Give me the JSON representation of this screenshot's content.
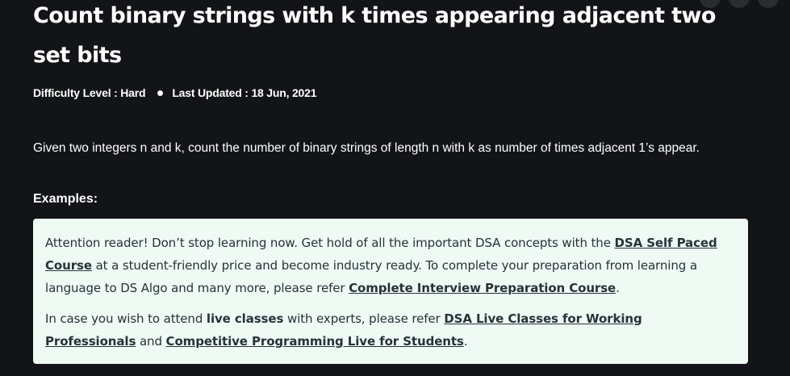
{
  "article": {
    "title": "Count binary strings with k times appearing adjacent two set bits",
    "difficulty": "Difficulty Level : Hard",
    "last_updated": "Last Updated : 18 Jun, 2021",
    "intro": "Given two integers n and k, count the number of binary strings of length n with k as number of times adjacent 1’s appear.",
    "examples_heading": "Examples:"
  },
  "notice": {
    "p1_text1": "Attention reader! Don’t stop learning now. Get hold of all the important DSA concepts with the ",
    "p1_link1": "DSA Self Paced Course",
    "p1_text2": " at a student-friendly price and become industry ready.  To complete your preparation from learning a language to DS Algo and many more,  please refer ",
    "p1_link2": "Complete Interview Preparation Course",
    "p1_text3": ".",
    "p2_text1": "In case you wish to attend ",
    "p2_bold": "live classes",
    "p2_text2": " with experts, please refer ",
    "p2_link1": "DSA Live Classes for Working Professionals",
    "p2_text3": " and ",
    "p2_link2": "Competitive Programming Live for Students",
    "p2_text4": "."
  },
  "colors": {
    "background": "#131417",
    "notice_background": "#effaf5",
    "notice_text": "#273239"
  }
}
